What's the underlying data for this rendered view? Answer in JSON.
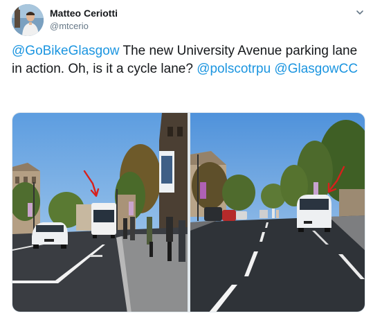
{
  "author": {
    "display_name": "Matteo Ceriotti",
    "handle": "@mtcerio"
  },
  "tweet": {
    "segments": [
      {
        "text": "@GoBikeGlasgow",
        "type": "mention"
      },
      {
        "text": " The new University Avenue parking lane in action. Oh, is it a cycle lane? ",
        "type": "text"
      },
      {
        "text": "@polscotrpu",
        "type": "mention"
      },
      {
        "text": " ",
        "type": "text"
      },
      {
        "text": "@GlasgowCC",
        "type": "mention"
      }
    ]
  },
  "media": {
    "photo_count": 2,
    "photos": [
      "street-photo-left",
      "street-photo-right"
    ]
  },
  "icons": {
    "menu": "chevron-down-icon"
  },
  "colors": {
    "link": "#1b95e0",
    "secondary_text": "#657786",
    "arrow_annotation": "#d8201c"
  }
}
